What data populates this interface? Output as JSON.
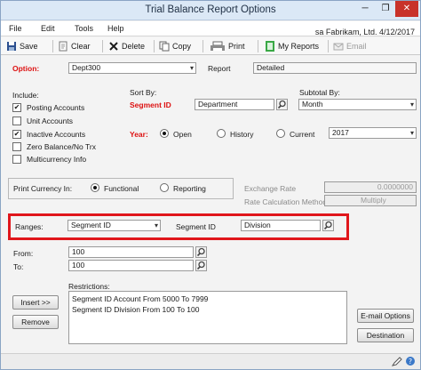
{
  "window": {
    "title": "Trial Balance Report Options"
  },
  "window_controls": {
    "minimize": "─",
    "restore": "❐",
    "close": "✕"
  },
  "menu": [
    "File",
    "Edit",
    "Tools",
    "Help"
  ],
  "info": {
    "text": "sa  Fabrikam, Ltd.  4/12/2017"
  },
  "toolbar": {
    "save": "Save",
    "clear": "Clear",
    "delete": "Delete",
    "copy": "Copy",
    "print": "Print",
    "my_reports": "My Reports",
    "email": "Email"
  },
  "option": {
    "label": "Option:",
    "value": "Dept300"
  },
  "report": {
    "label": "Report",
    "value": "Detailed"
  },
  "include": {
    "label": "Include:",
    "items": [
      {
        "label": "Posting Accounts",
        "checked": true
      },
      {
        "label": "Unit Accounts",
        "checked": false
      },
      {
        "label": "Inactive Accounts",
        "checked": true
      },
      {
        "label": "Zero Balance/No Trx",
        "checked": false
      },
      {
        "label": "Multicurrency Info",
        "checked": false
      }
    ]
  },
  "sort_by": {
    "label": "Sort By:",
    "field_label": "Segment ID",
    "value": "Department"
  },
  "subtotal_by": {
    "label": "Subtotal By:",
    "value": "Month"
  },
  "year": {
    "label": "Year:",
    "open": "Open",
    "history": "History",
    "current": "Current",
    "value": "2017"
  },
  "print_currency": {
    "label": "Print Currency In:",
    "functional": "Functional",
    "reporting": "Reporting"
  },
  "exchange_rate": {
    "label": "Exchange Rate",
    "value": "0.0000000"
  },
  "rate_method": {
    "label": "Rate Calculation Method:",
    "value": "Multiply"
  },
  "ranges": {
    "label": "Ranges:",
    "value": "Segment ID",
    "segment_label": "Segment ID",
    "segment_value": "Division"
  },
  "from": {
    "label": "From:",
    "value": "100"
  },
  "to": {
    "label": "To:",
    "value": "100"
  },
  "restrictions": {
    "label": "Restrictions:",
    "items": [
      "Segment ID Account From 5000 To 7999",
      "Segment ID Division From 100 To 100"
    ]
  },
  "buttons": {
    "insert": "Insert >>",
    "remove": "Remove",
    "email_options": "E-mail Options",
    "destination": "Destination"
  },
  "colors": {
    "highlight": "#e0161b",
    "required": "#dd1111"
  }
}
